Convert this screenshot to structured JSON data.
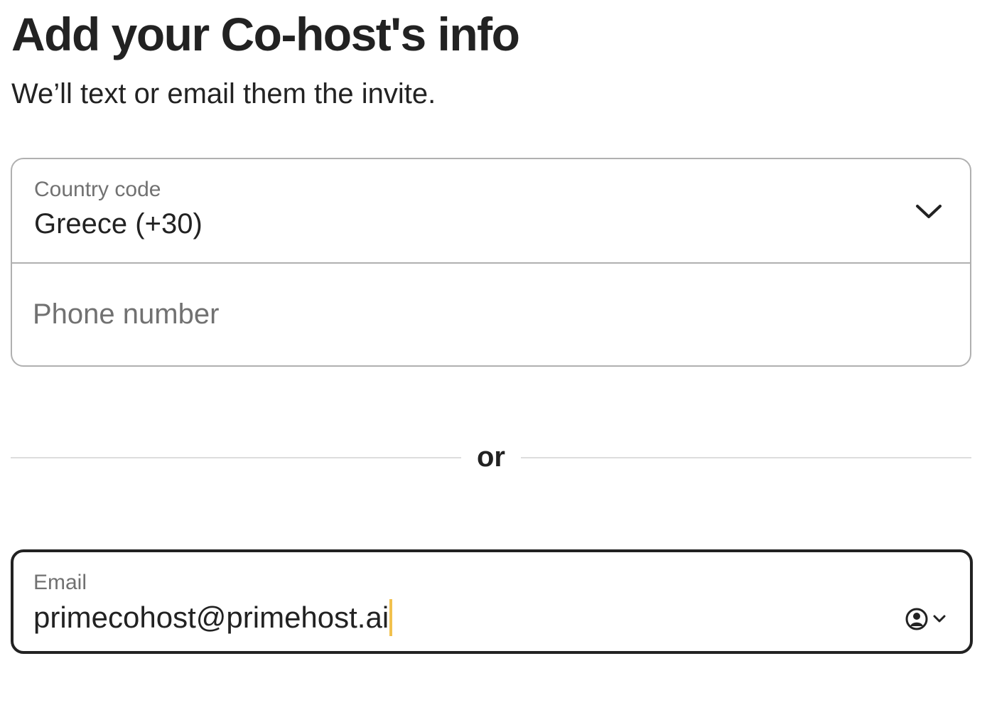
{
  "header": {
    "title": "Add your Co-host's info",
    "subtitle": "We’ll text or email them the invite."
  },
  "phone": {
    "country_label": "Country code",
    "country_value": "Greece (+30)",
    "country_icon": "chevron-down-icon",
    "phone_placeholder": "Phone number",
    "phone_value": ""
  },
  "divider": {
    "text": "or"
  },
  "email": {
    "label": "Email",
    "value": "primecohost@primehost.ai",
    "autofill_icon": "account-autofill-icon",
    "caret_color": "#f2c14e"
  },
  "colors": {
    "text": "#222222",
    "muted": "#717171",
    "border": "#b0b0b0",
    "focus_border": "#222222",
    "divider": "#dddddd"
  }
}
